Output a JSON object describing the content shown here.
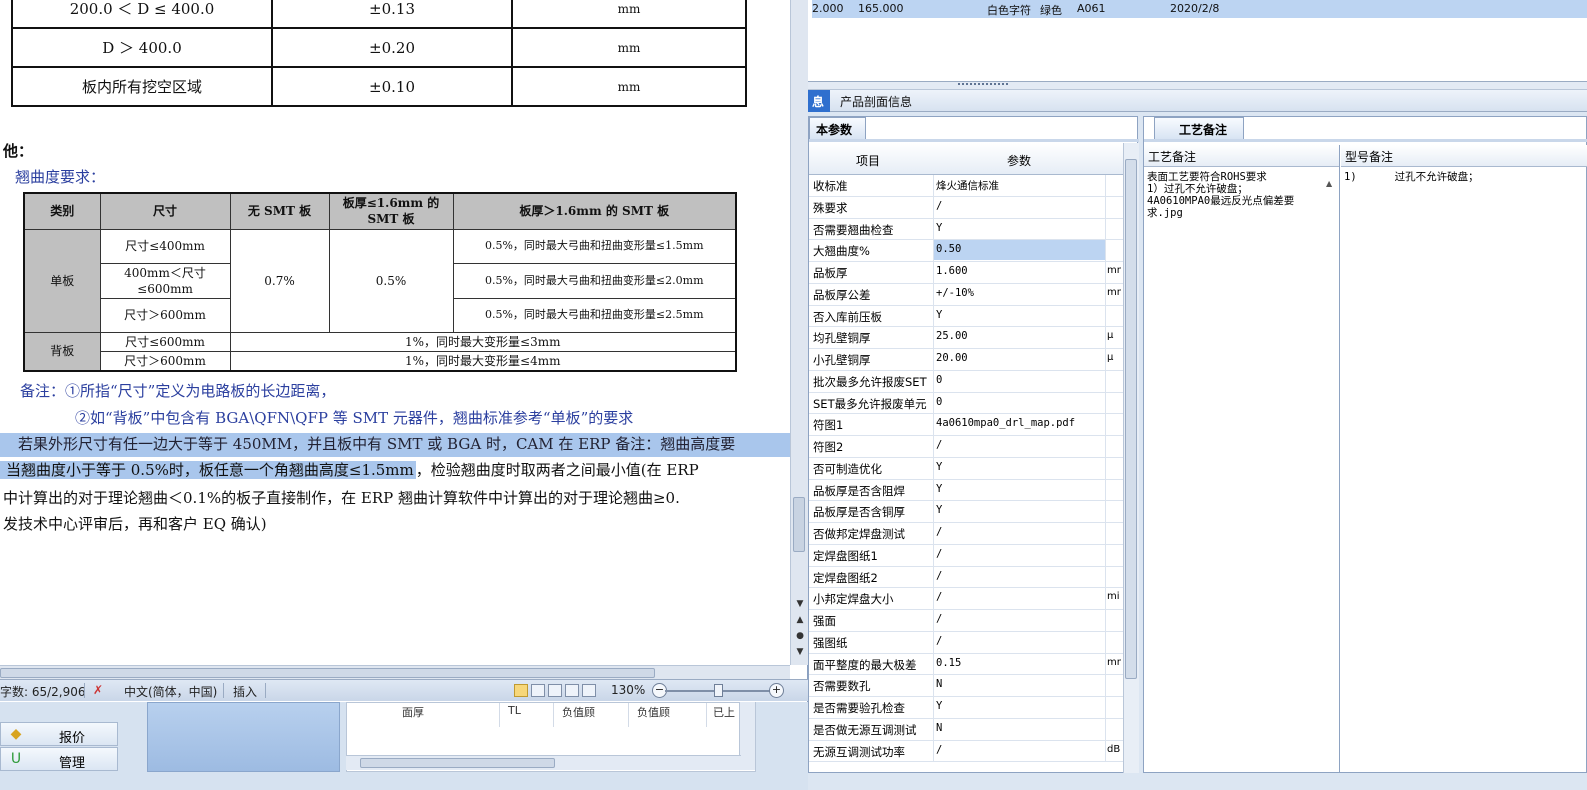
{
  "doc": {
    "tolerance_rows": [
      {
        "range": "200.0 ＜ D ≤ 400.0",
        "tol": "±0.13",
        "unit": "mm"
      },
      {
        "range": "D ＞ 400.0",
        "tol": "±0.20",
        "unit": "mm"
      },
      {
        "range": "板内所有挖空区域",
        "tol": "±0.10",
        "unit": "mm"
      }
    ],
    "section_other": "他：",
    "warp_title": "翘曲度要求：",
    "warp_table": {
      "headers": [
        "类别",
        "尺寸",
        "无 SMT 板",
        "板厚≤1.6mm 的 SMT 板",
        "板厚＞1.6mm 的 SMT 板"
      ],
      "single_board": "单板",
      "backplane": "背板",
      "single_sizes": [
        "尺寸≤400mm",
        "400mm＜尺寸≤600mm",
        "尺寸＞600mm"
      ],
      "no_smt_value": "0.7%",
      "smt_thin_value": "0.5%",
      "smt_thick_values": [
        "0.5%，同时最大弓曲和扭曲变形量≤1.5mm",
        "0.5%，同时最大弓曲和扭曲变形量≤2.0mm",
        "0.5%，同时最大弓曲和扭曲变形量≤2.5mm"
      ],
      "back_sizes": [
        "尺寸≤600mm",
        "尺寸＞600mm"
      ],
      "back_values": [
        "1%，同时最大变形量≤3mm",
        "1%，同时最大变形量≤4mm"
      ]
    },
    "note1": "备注：①所指“尺寸”定义为电路板的长边距离，",
    "note2": "②如“背板”中包含有 BGA\\QFN\\QFP 等 SMT 元器件，翘曲标准参考“单板”的要求",
    "para1": "若果外形尺寸有任一边大于等于 450MM，并且板中有 SMT 或 BGA 时，CAM 在 ERP 备注：翘曲高度要",
    "para2_hl": "当翘曲度小于等于 0.5%时，板任意一个角翘曲高度≤1.5mm",
    "para2_rest": "，检验翘曲度时取两者之间最小值(在 ERP",
    "para3": "中计算出的对于理论翘曲＜0.1%的板子直接制作，在 ERP 翘曲计算软件中计算出的对于理论翘曲≥0.",
    "para4": "发技术中心评审后，再和客户 EQ 确认)"
  },
  "status_bar": {
    "word_count": "字数: 65/2,906",
    "language": "中文(简体，中国)",
    "mode": "插入",
    "zoom": "130%"
  },
  "bg_left": {
    "nav_quote": "报价",
    "nav_manage": "管理",
    "grid_cells": [
      "面厚",
      "TL",
      "负值顾",
      "负值顾",
      "已上"
    ]
  },
  "erp": {
    "top_row": [
      "2.000",
      "165.000",
      "白色字符",
      "绿色",
      "A061",
      "2020/2/8"
    ],
    "tab_info": "息",
    "tab_section": "产品剖面信息",
    "params_tab": "本参数",
    "params_header": {
      "item": "项目",
      "param": "参数"
    },
    "params": [
      {
        "k": "收标准",
        "v": "烽火通信标准",
        "u": ""
      },
      {
        "k": "殊要求",
        "v": "/",
        "u": ""
      },
      {
        "k": "否需要翘曲检查",
        "v": "Y",
        "u": ""
      },
      {
        "k": "大翘曲度%",
        "v": "0.50",
        "u": ""
      },
      {
        "k": "品板厚",
        "v": "1.600",
        "u": "mm"
      },
      {
        "k": "品板厚公差",
        "v": "+/-10%",
        "u": "mm"
      },
      {
        "k": "否入库前压板",
        "v": "Y",
        "u": ""
      },
      {
        "k": "均孔壁铜厚",
        "v": "25.00",
        "u": "μ"
      },
      {
        "k": "小孔壁铜厚",
        "v": "20.00",
        "u": "μ"
      },
      {
        "k": "批次最多允许报废SET",
        "v": "0",
        "u": ""
      },
      {
        "k": "SET最多允许报废单元",
        "v": "0",
        "u": ""
      },
      {
        "k": "符图1",
        "v": "4a0610mpa0_drl_map.pdf",
        "u": ""
      },
      {
        "k": "符图2",
        "v": "/",
        "u": ""
      },
      {
        "k": "否可制造优化",
        "v": "Y",
        "u": ""
      },
      {
        "k": "品板厚是否含阻焊",
        "v": "Y",
        "u": ""
      },
      {
        "k": "品板厚是否含铜厚",
        "v": "Y",
        "u": ""
      },
      {
        "k": "否做邦定焊盘测试",
        "v": "/",
        "u": ""
      },
      {
        "k": "定焊盘图纸1",
        "v": "/",
        "u": ""
      },
      {
        "k": "定焊盘图纸2",
        "v": "/",
        "u": ""
      },
      {
        "k": "小邦定焊盘大小",
        "v": "/",
        "u": "mi"
      },
      {
        "k": "强面",
        "v": "/",
        "u": ""
      },
      {
        "k": "强图纸",
        "v": "/",
        "u": ""
      },
      {
        "k": "面平整度的最大极差",
        "v": "0.15",
        "u": "mm"
      },
      {
        "k": "否需要数孔",
        "v": "N",
        "u": ""
      },
      {
        "k": "是否需要验孔检查",
        "v": "Y",
        "u": ""
      },
      {
        "k": "是否做无源互调测试",
        "v": "N",
        "u": ""
      },
      {
        "k": "无源互调测试功率",
        "v": "/",
        "u": "dB"
      }
    ],
    "notes_tab": "工艺备注",
    "notes_col1_head": "工艺备注",
    "notes_col1_text": "表面工艺要符合ROHS要求\n1）过孔不允许破盘；\n4A0610MPA0最远反光点偏差要求.jpg",
    "notes_col2_head": "型号备注",
    "notes_col2_text": "1)      过孔不允许破盘；"
  },
  "colors": {
    "selection": "#a9c6ec",
    "row_highlight": "#bcd4f2",
    "doc_blue_text": "#2b3f9f",
    "tab_active": "#2f6fce"
  }
}
